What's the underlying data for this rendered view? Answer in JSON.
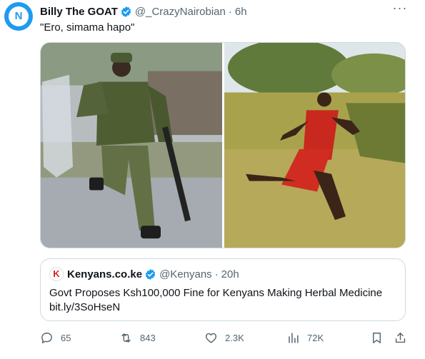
{
  "tweet": {
    "author_name": "Billy The GOAT",
    "handle": "@_CrazyNairobian",
    "separator": "·",
    "time": "6h",
    "text": "\"Ero, simama hapo\""
  },
  "media": {
    "left_image": "photo-riot-police-officer-running",
    "right_image": "photo-maasai-man-running-in-red-shuka"
  },
  "quote": {
    "author_name": "Kenyans.co.ke",
    "handle": "@Kenyans",
    "separator": "·",
    "time": "20h",
    "text": "Govt Proposes Ksh100,000 Fine for Kenyans Making Herbal Medicine",
    "link": "bit.ly/3SoHseN",
    "logo_letter": "K"
  },
  "actions": {
    "replies": "65",
    "reposts": "843",
    "likes": "2.3K",
    "views": "72K"
  },
  "colors": {
    "verified": "#1d9bf0",
    "muted": "#536471",
    "brand": "#1d9bf0"
  }
}
